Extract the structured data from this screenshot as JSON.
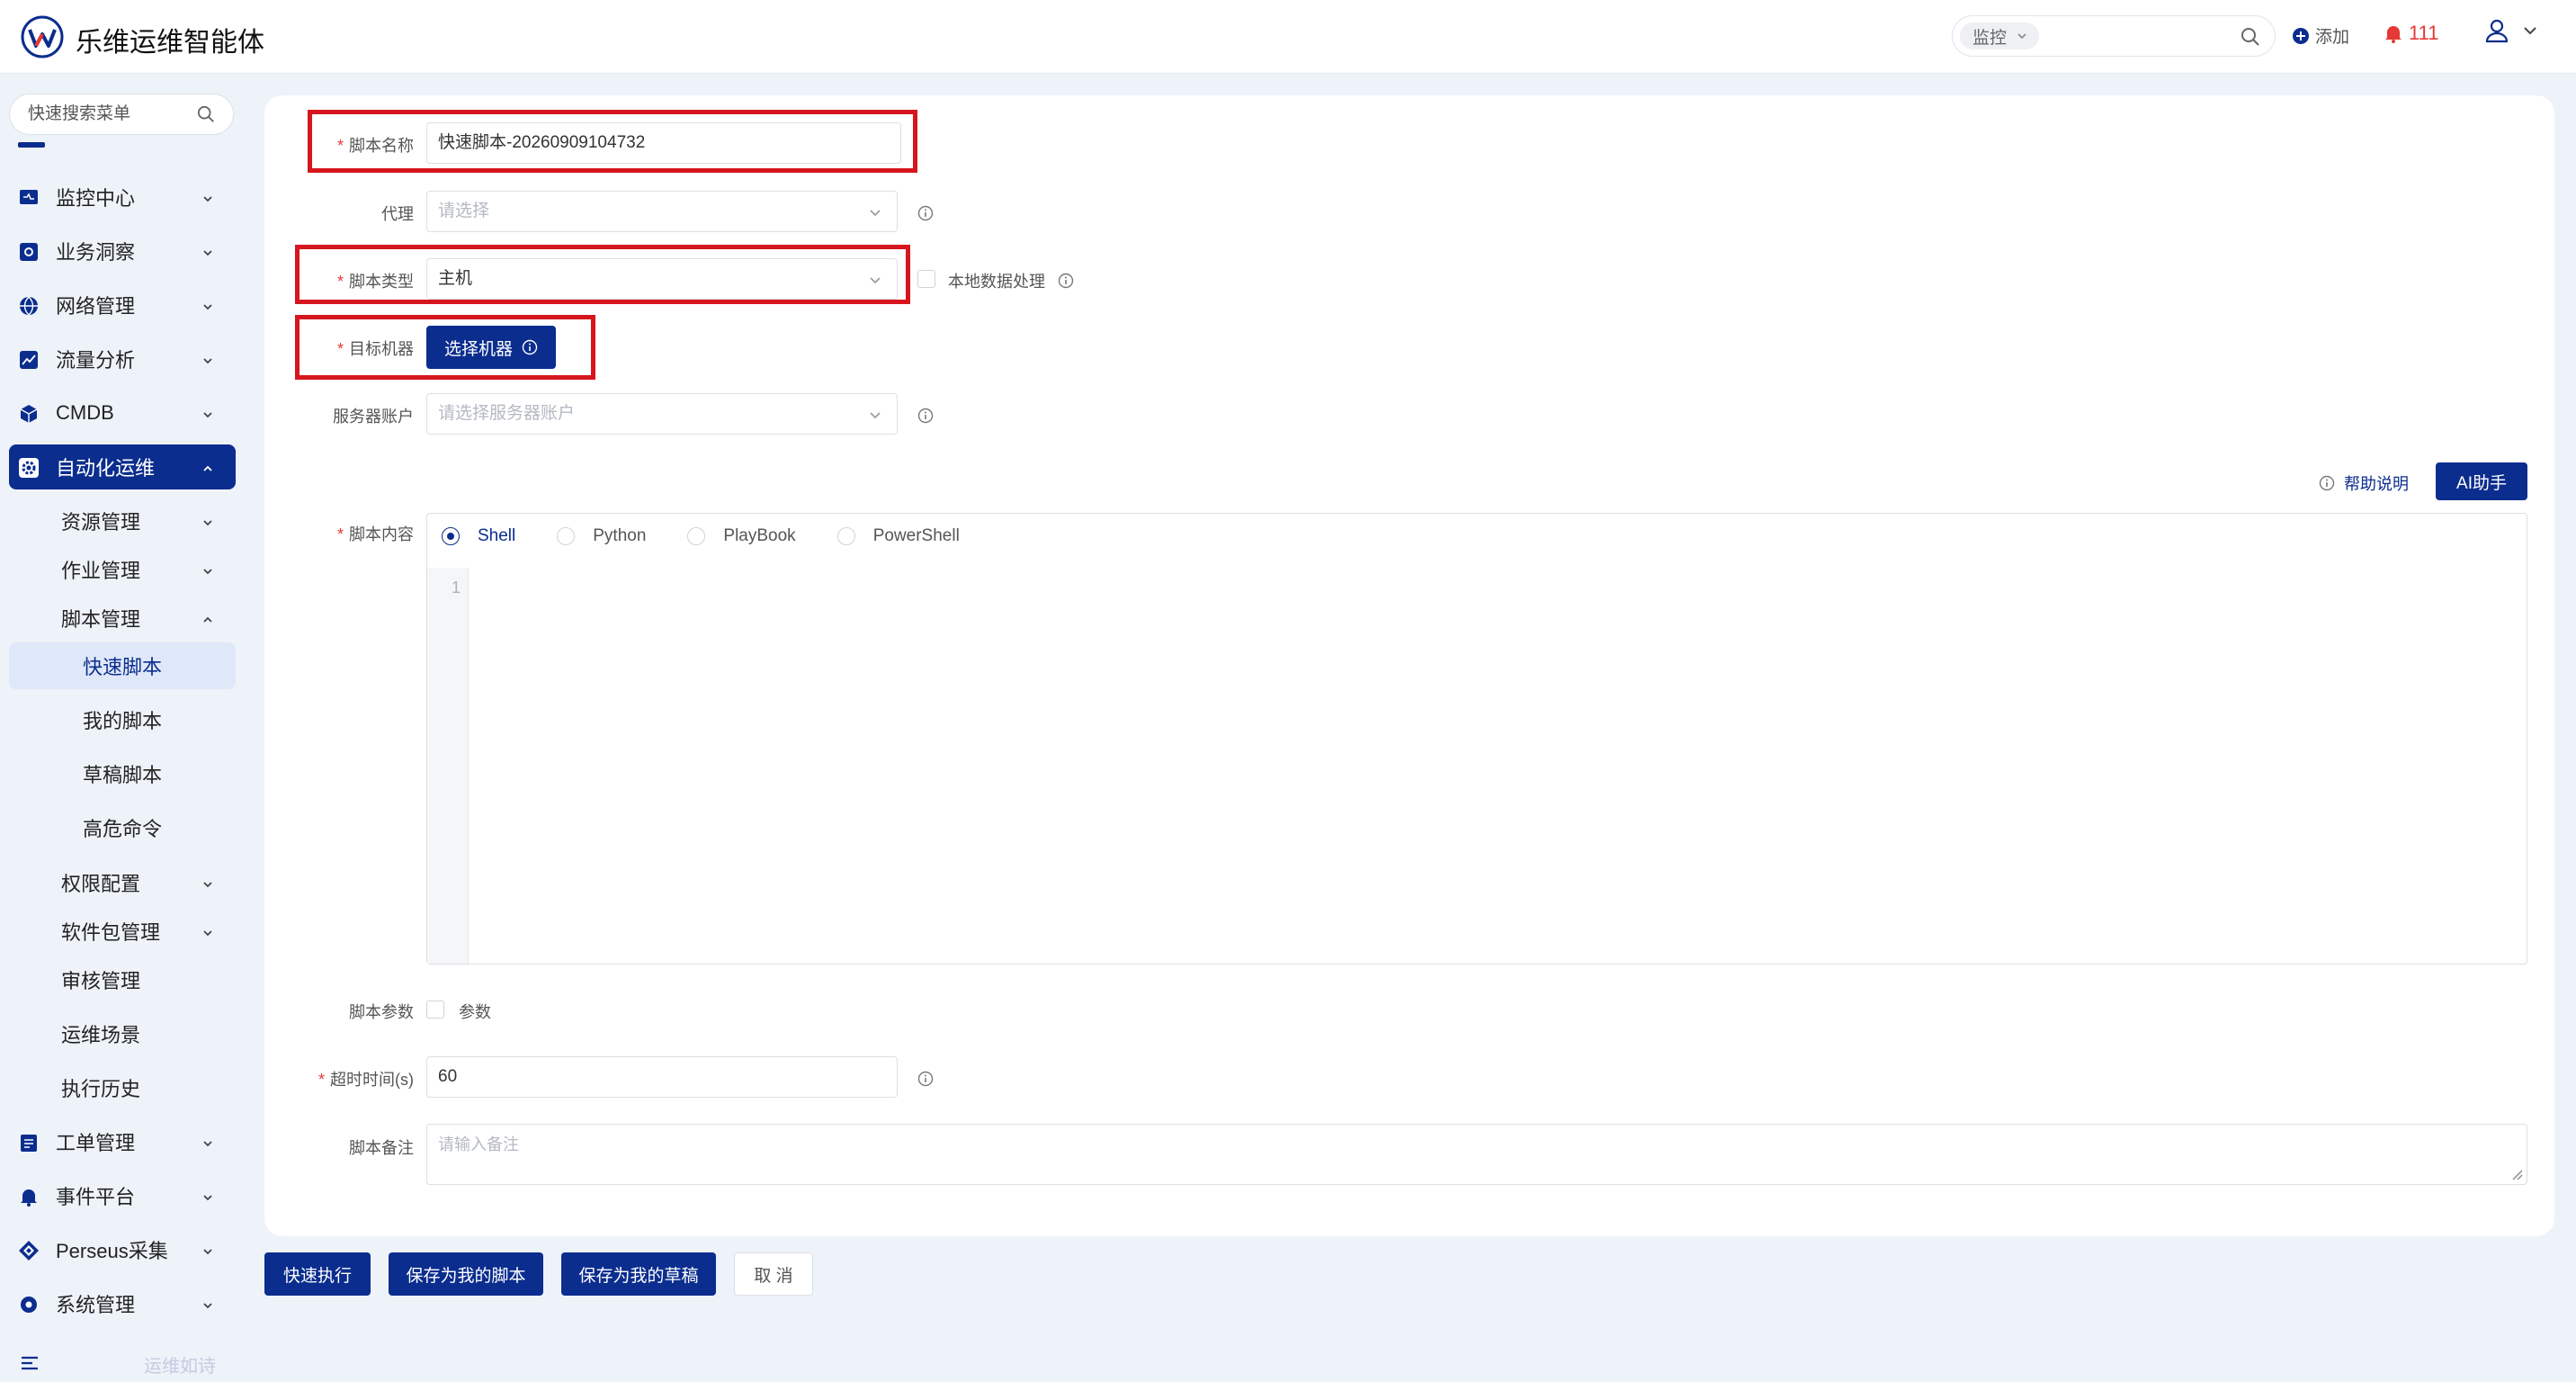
{
  "header": {
    "title": "乐维运维智能体",
    "search_scope": "监控",
    "add_label": "添加",
    "alert_count": "111"
  },
  "sidebar": {
    "search_placeholder": "快速搜索菜单",
    "items": [
      {
        "label": "监控中心",
        "icon": "monitor-icon"
      },
      {
        "label": "业务洞察",
        "icon": "insight-icon"
      },
      {
        "label": "网络管理",
        "icon": "globe-icon"
      },
      {
        "label": "流量分析",
        "icon": "chart-icon"
      },
      {
        "label": "CMDB",
        "icon": "cube-icon"
      },
      {
        "label": "自动化运维",
        "icon": "gear-icon"
      }
    ],
    "sub_items": [
      {
        "label": "资源管理"
      },
      {
        "label": "作业管理"
      },
      {
        "label": "脚本管理"
      }
    ],
    "leaf_items": [
      {
        "label": "快速脚本"
      },
      {
        "label": "我的脚本"
      },
      {
        "label": "草稿脚本"
      },
      {
        "label": "高危命令"
      }
    ],
    "sub_items2": [
      {
        "label": "权限配置"
      },
      {
        "label": "软件包管理"
      },
      {
        "label": "审核管理"
      },
      {
        "label": "运维场景"
      },
      {
        "label": "执行历史"
      }
    ],
    "items2": [
      {
        "label": "工单管理",
        "icon": "ticket-icon"
      },
      {
        "label": "事件平台",
        "icon": "bell-icon"
      },
      {
        "label": "Perseus采集",
        "icon": "diamond-icon"
      },
      {
        "label": "系统管理",
        "icon": "settings-icon"
      }
    ],
    "footer_text": "运维如诗"
  },
  "form": {
    "script_name_label": "脚本名称",
    "script_name_value": "快速脚本-20260909104732",
    "proxy_label": "代理",
    "proxy_placeholder": "请选择",
    "script_type_label": "脚本类型",
    "script_type_value": "主机",
    "local_data_label": "本地数据处理",
    "target_label": "目标机器",
    "select_machine_button": "选择机器",
    "server_account_label": "服务器账户",
    "server_account_placeholder": "请选择服务器账户",
    "help_label": "帮助说明",
    "ai_button": "AI助手",
    "content_label": "脚本内容",
    "languages": [
      "Shell",
      "Python",
      "PlayBook",
      "PowerShell"
    ],
    "selected_language": "Shell",
    "line_number": "1",
    "params_label": "脚本参数",
    "params_checkbox_label": "参数",
    "timeout_label": "超时时间(s)",
    "timeout_value": "60",
    "remark_label": "脚本备注",
    "remark_placeholder": "请输入备注"
  },
  "actions": {
    "quick_exec": "快速执行",
    "save_mine": "保存为我的脚本",
    "save_draft": "保存为我的草稿",
    "cancel": "取 消"
  },
  "colors": {
    "primary": "#0b2d8e",
    "highlight": "#d6161e",
    "alert": "#e53935"
  }
}
